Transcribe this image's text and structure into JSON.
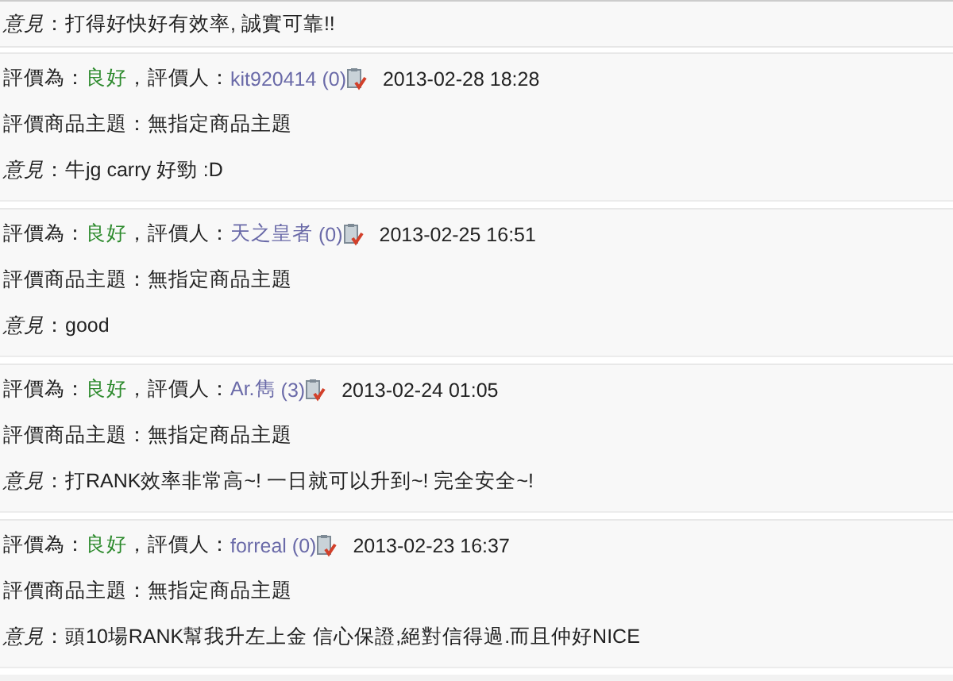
{
  "top_comment": {
    "label": "意見",
    "text": "：打得好快好有效率, 誠實可靠!!"
  },
  "reviews": [
    {
      "rating_label": "評價為：",
      "rating": "良好",
      "reviewer_label": "，評價人：",
      "reviewer": "kit920414",
      "score": "(0)",
      "date": "2013-02-28 18:28",
      "subject": "評價商品主題：無指定商品主題",
      "comment_label": "意見",
      "comment": "：牛jg carry 好勁 :D"
    },
    {
      "rating_label": "評價為：",
      "rating": "良好",
      "reviewer_label": "，評價人：",
      "reviewer": "天之皇者",
      "score": "(0)",
      "date": "2013-02-25 16:51",
      "subject": "評價商品主題：無指定商品主題",
      "comment_label": "意見",
      "comment": "：good"
    },
    {
      "rating_label": "評價為：",
      "rating": "良好",
      "reviewer_label": "，評價人：",
      "reviewer": "Ar.雋",
      "score": "(3)",
      "date": "2013-02-24 01:05",
      "subject": "評價商品主題：無指定商品主題",
      "comment_label": "意見",
      "comment": "：打RANK效率非常高~! 一日就可以升到~! 完全安全~!"
    },
    {
      "rating_label": "評價為：",
      "rating": "良好",
      "reviewer_label": "，評價人：",
      "reviewer": "forreal",
      "score": "(0)",
      "date": "2013-02-23 16:37",
      "subject": "評價商品主題：無指定商品主題",
      "comment_label": "意見",
      "comment": "：頭10場RANK幫我升左上金 信心保證,絕對信得過.而且仲好NICE"
    }
  ]
}
